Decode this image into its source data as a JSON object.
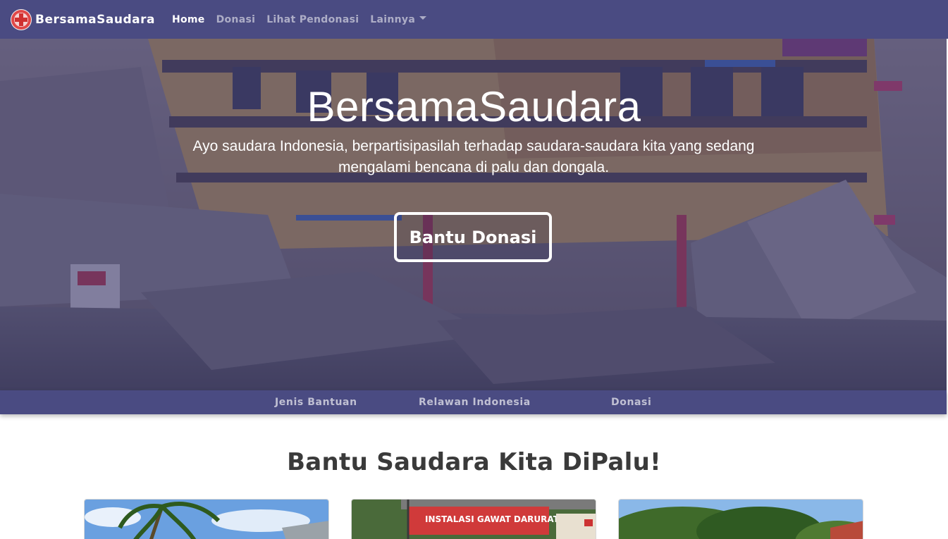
{
  "navbar": {
    "brand": "BersamaSaudara",
    "links": [
      {
        "label": "Home",
        "active": true
      },
      {
        "label": "Donasi",
        "active": false
      },
      {
        "label": "Lihat Pendonasi",
        "active": false
      },
      {
        "label": "Lainnya",
        "active": false,
        "dropdown": true
      }
    ]
  },
  "hero": {
    "title": "BersamaSaudara",
    "subtitle": "Ayo saudara Indonesia, berpartisipasilah terhadap saudara-saudara kita yang sedang mengalami bencana di palu dan dongala.",
    "button_label": "Bantu Donasi"
  },
  "subnav": {
    "items": [
      "Jenis Bantuan",
      "Relawan Indonesia",
      "Donasi"
    ]
  },
  "section": {
    "title": "Bantu Saudara Kita DiPalu!",
    "card2_sign": "INSTALASI GAWAT DARURAT"
  },
  "colors": {
    "navbar": "#4a4b82",
    "hero_overlay": "#3a3878",
    "title_text": "#3a3a3a"
  },
  "icons": [
    "red-cross-logo-icon",
    "chevron-down-icon"
  ]
}
